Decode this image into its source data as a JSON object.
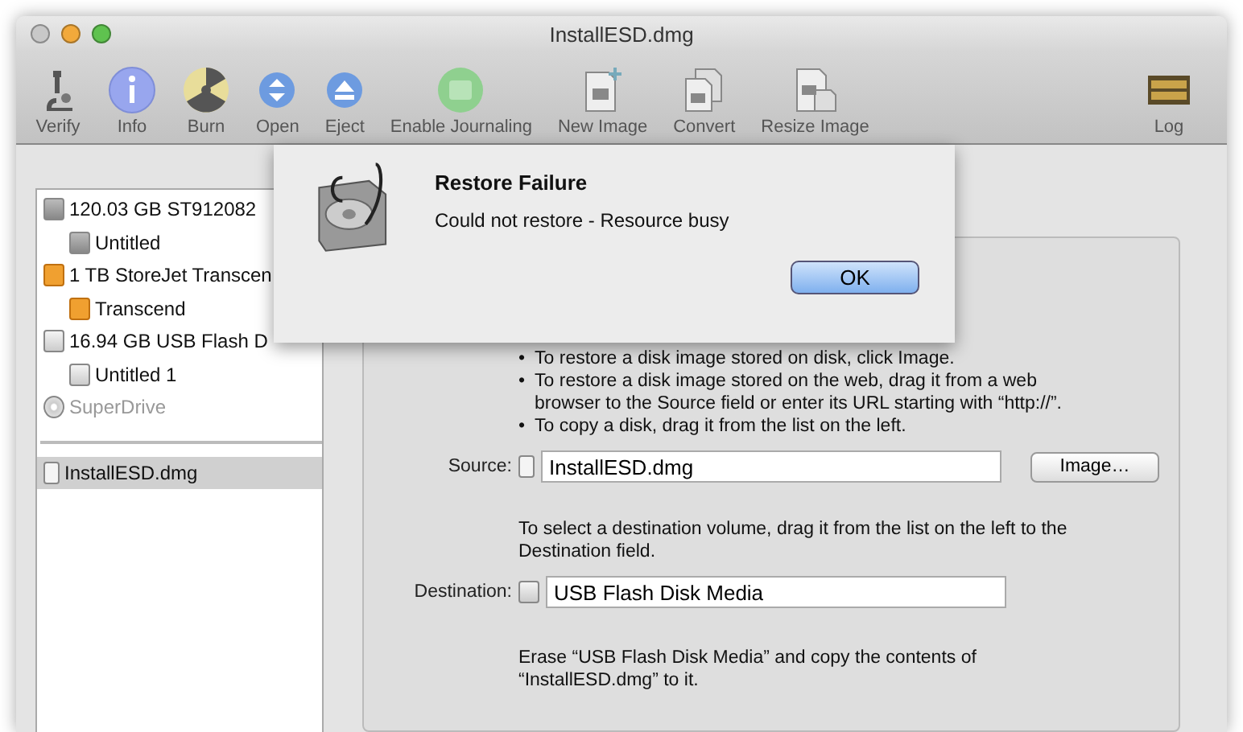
{
  "window": {
    "title": "InstallESD.dmg"
  },
  "toolbar": [
    {
      "label": "Verify",
      "kind": "microscope"
    },
    {
      "label": "Info",
      "kind": "info"
    },
    {
      "label": "Burn",
      "kind": "burn"
    },
    {
      "label": "Open",
      "kind": "open"
    },
    {
      "label": "Eject",
      "kind": "eject"
    },
    {
      "label": "Enable Journaling",
      "kind": "journal"
    },
    {
      "label": "New Image",
      "kind": "newimage"
    },
    {
      "label": "Convert",
      "kind": "convert"
    },
    {
      "label": "Resize Image",
      "kind": "resize"
    }
  ],
  "log_button": {
    "label": "Log"
  },
  "sidebar": {
    "devices": [
      {
        "label": "120.03 GB ST912082",
        "kind": "hdd",
        "selected": false,
        "disabled": false,
        "children": [
          {
            "label": "Untitled",
            "kind": "hdd",
            "selected": false,
            "disabled": false
          }
        ]
      },
      {
        "label": "1 TB StoreJet Transcen",
        "kind": "usb",
        "selected": false,
        "disabled": false,
        "children": [
          {
            "label": "Transcend",
            "kind": "usb",
            "selected": false,
            "disabled": false
          }
        ]
      },
      {
        "label": "16.94 GB USB Flash D",
        "kind": "flash",
        "selected": false,
        "disabled": false,
        "children": [
          {
            "label": "Untitled 1",
            "kind": "flash",
            "selected": false,
            "disabled": false
          }
        ]
      },
      {
        "label": "SuperDrive",
        "kind": "optical",
        "selected": false,
        "disabled": true
      }
    ],
    "images": [
      {
        "label": "InstallESD.dmg",
        "kind": "dmg",
        "selected": true,
        "disabled": false
      }
    ]
  },
  "restore": {
    "bullets": [
      {
        "marker": "•",
        "text": "To restore a disk image stored on disk, click Image."
      },
      {
        "marker": "•",
        "text": "To restore a disk image stored on the web, drag it from a web browser to the Source field or enter its URL starting with “http://”."
      },
      {
        "marker": "•",
        "text": "To copy a disk, drag it from the list on the left."
      }
    ],
    "source": {
      "label": "Source:",
      "value": "InstallESD.dmg",
      "button": "Image…"
    },
    "destination_hint": "To select a destination volume, drag it from the list on the left to the Destination field.",
    "destination": {
      "label": "Destination:",
      "value": "USB Flash Disk Media"
    },
    "summary": "Erase “USB Flash Disk Media” and copy the contents of “InstallESD.dmg” to it."
  },
  "dialog": {
    "title": "Restore Failure",
    "message": "Could not restore - Resource busy",
    "button": "OK"
  }
}
